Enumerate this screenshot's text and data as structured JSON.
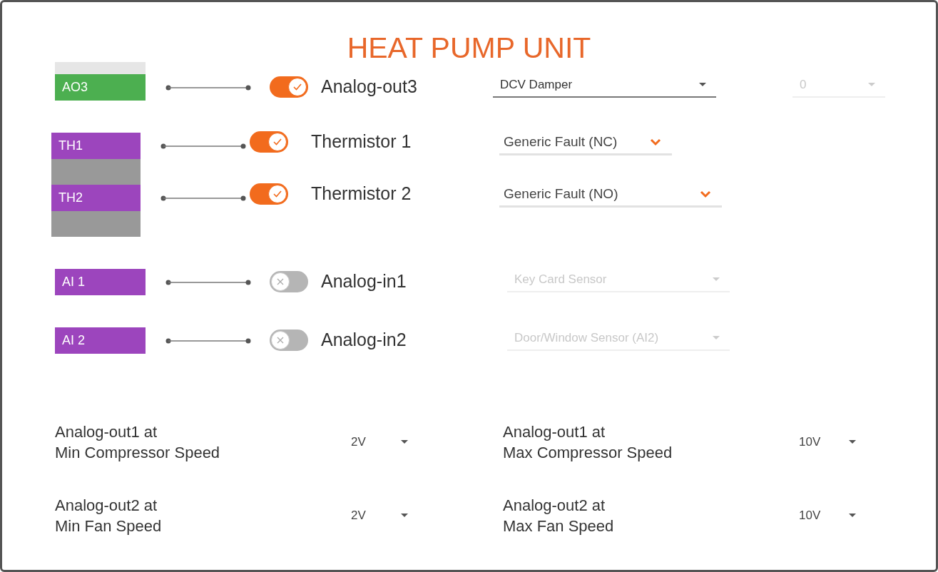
{
  "title": "HEAT PUMP UNIT",
  "rows": [
    {
      "kind": "output",
      "tag": "AO3",
      "color": "#4caf50",
      "on": true,
      "label": "Analog-out3",
      "dropdowns": [
        {
          "kind": "caret",
          "value": "DCV Damper",
          "disabled": false
        },
        {
          "kind": "caret",
          "value": "0",
          "disabled": true
        }
      ]
    },
    {
      "kind": "thermistor",
      "tag": "TH1",
      "color": "#9c45bd",
      "on": true,
      "label": "Thermistor 1",
      "dropdowns": [
        {
          "kind": "chevron",
          "value": "Generic Fault (NC)",
          "disabled": false
        }
      ]
    },
    {
      "kind": "thermistor",
      "tag": "TH2",
      "color": "#9c45bd",
      "on": true,
      "label": "Thermistor 2",
      "dropdowns": [
        {
          "kind": "chevron",
          "value": "Generic Fault (NO)",
          "disabled": false
        }
      ]
    },
    {
      "kind": "input",
      "tag": "AI 1",
      "color": "#9c45bd",
      "on": false,
      "label": "Analog-in1",
      "dropdowns": [
        {
          "kind": "caret",
          "value": "Key Card Sensor",
          "disabled": true
        }
      ]
    },
    {
      "kind": "input",
      "tag": "AI 2",
      "color": "#9c45bd",
      "on": false,
      "label": "Analog-in2",
      "dropdowns": [
        {
          "kind": "caret",
          "value": "Door/Window Sensor (AI2)",
          "disabled": true
        }
      ]
    }
  ],
  "settings": [
    {
      "label": "Analog-out1 at\nMin Compressor Speed",
      "value": "2V"
    },
    {
      "label": "Analog-out1 at\nMax Compressor Speed",
      "value": "10V"
    },
    {
      "label": "Analog-out2 at\nMin Fan Speed",
      "value": "2V"
    },
    {
      "label": "Analog-out2 at\nMax Fan Speed",
      "value": "10V"
    }
  ]
}
